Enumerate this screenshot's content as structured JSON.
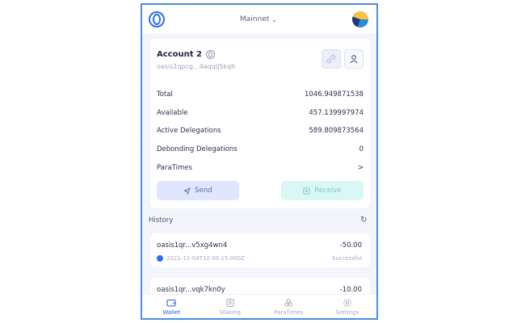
{
  "header": {
    "network": "Mainnet"
  },
  "account": {
    "name": "Account 2",
    "address": "oasis1qpcg...4aqqlj5kqh"
  },
  "balances": [
    {
      "label": "Total",
      "value": "1046.949871538"
    },
    {
      "label": "Available",
      "value": "457.139997974"
    },
    {
      "label": "Active Delegations",
      "value": "589.809873564"
    },
    {
      "label": "Debonding Delegations",
      "value": "0"
    },
    {
      "label": "ParaTimes",
      "value": ">"
    }
  ],
  "actions": {
    "send": "Send",
    "receive": "Receive"
  },
  "history": {
    "title": "History",
    "items": [
      {
        "address": "oasis1qr...v5xg4wn4",
        "amount": "-50.00",
        "time": "2021-11-04T12:00:15.000Z",
        "status": "Successful"
      },
      {
        "address": "oasis1qr...vqk7kn0y",
        "amount": "-10.00"
      }
    ]
  },
  "nav": [
    {
      "label": "Wallet",
      "icon": "wallet-icon",
      "active": true
    },
    {
      "label": "Staking",
      "icon": "staking-icon"
    },
    {
      "label": "ParaTimes",
      "icon": "paratimes-icon"
    },
    {
      "label": "Settings",
      "icon": "settings-icon"
    }
  ],
  "colors": {
    "accent": "#2f6ee8",
    "frame": "#4a8fe0",
    "send_bg": "#dfe6fd",
    "receive_bg": "#d9f7f4"
  }
}
